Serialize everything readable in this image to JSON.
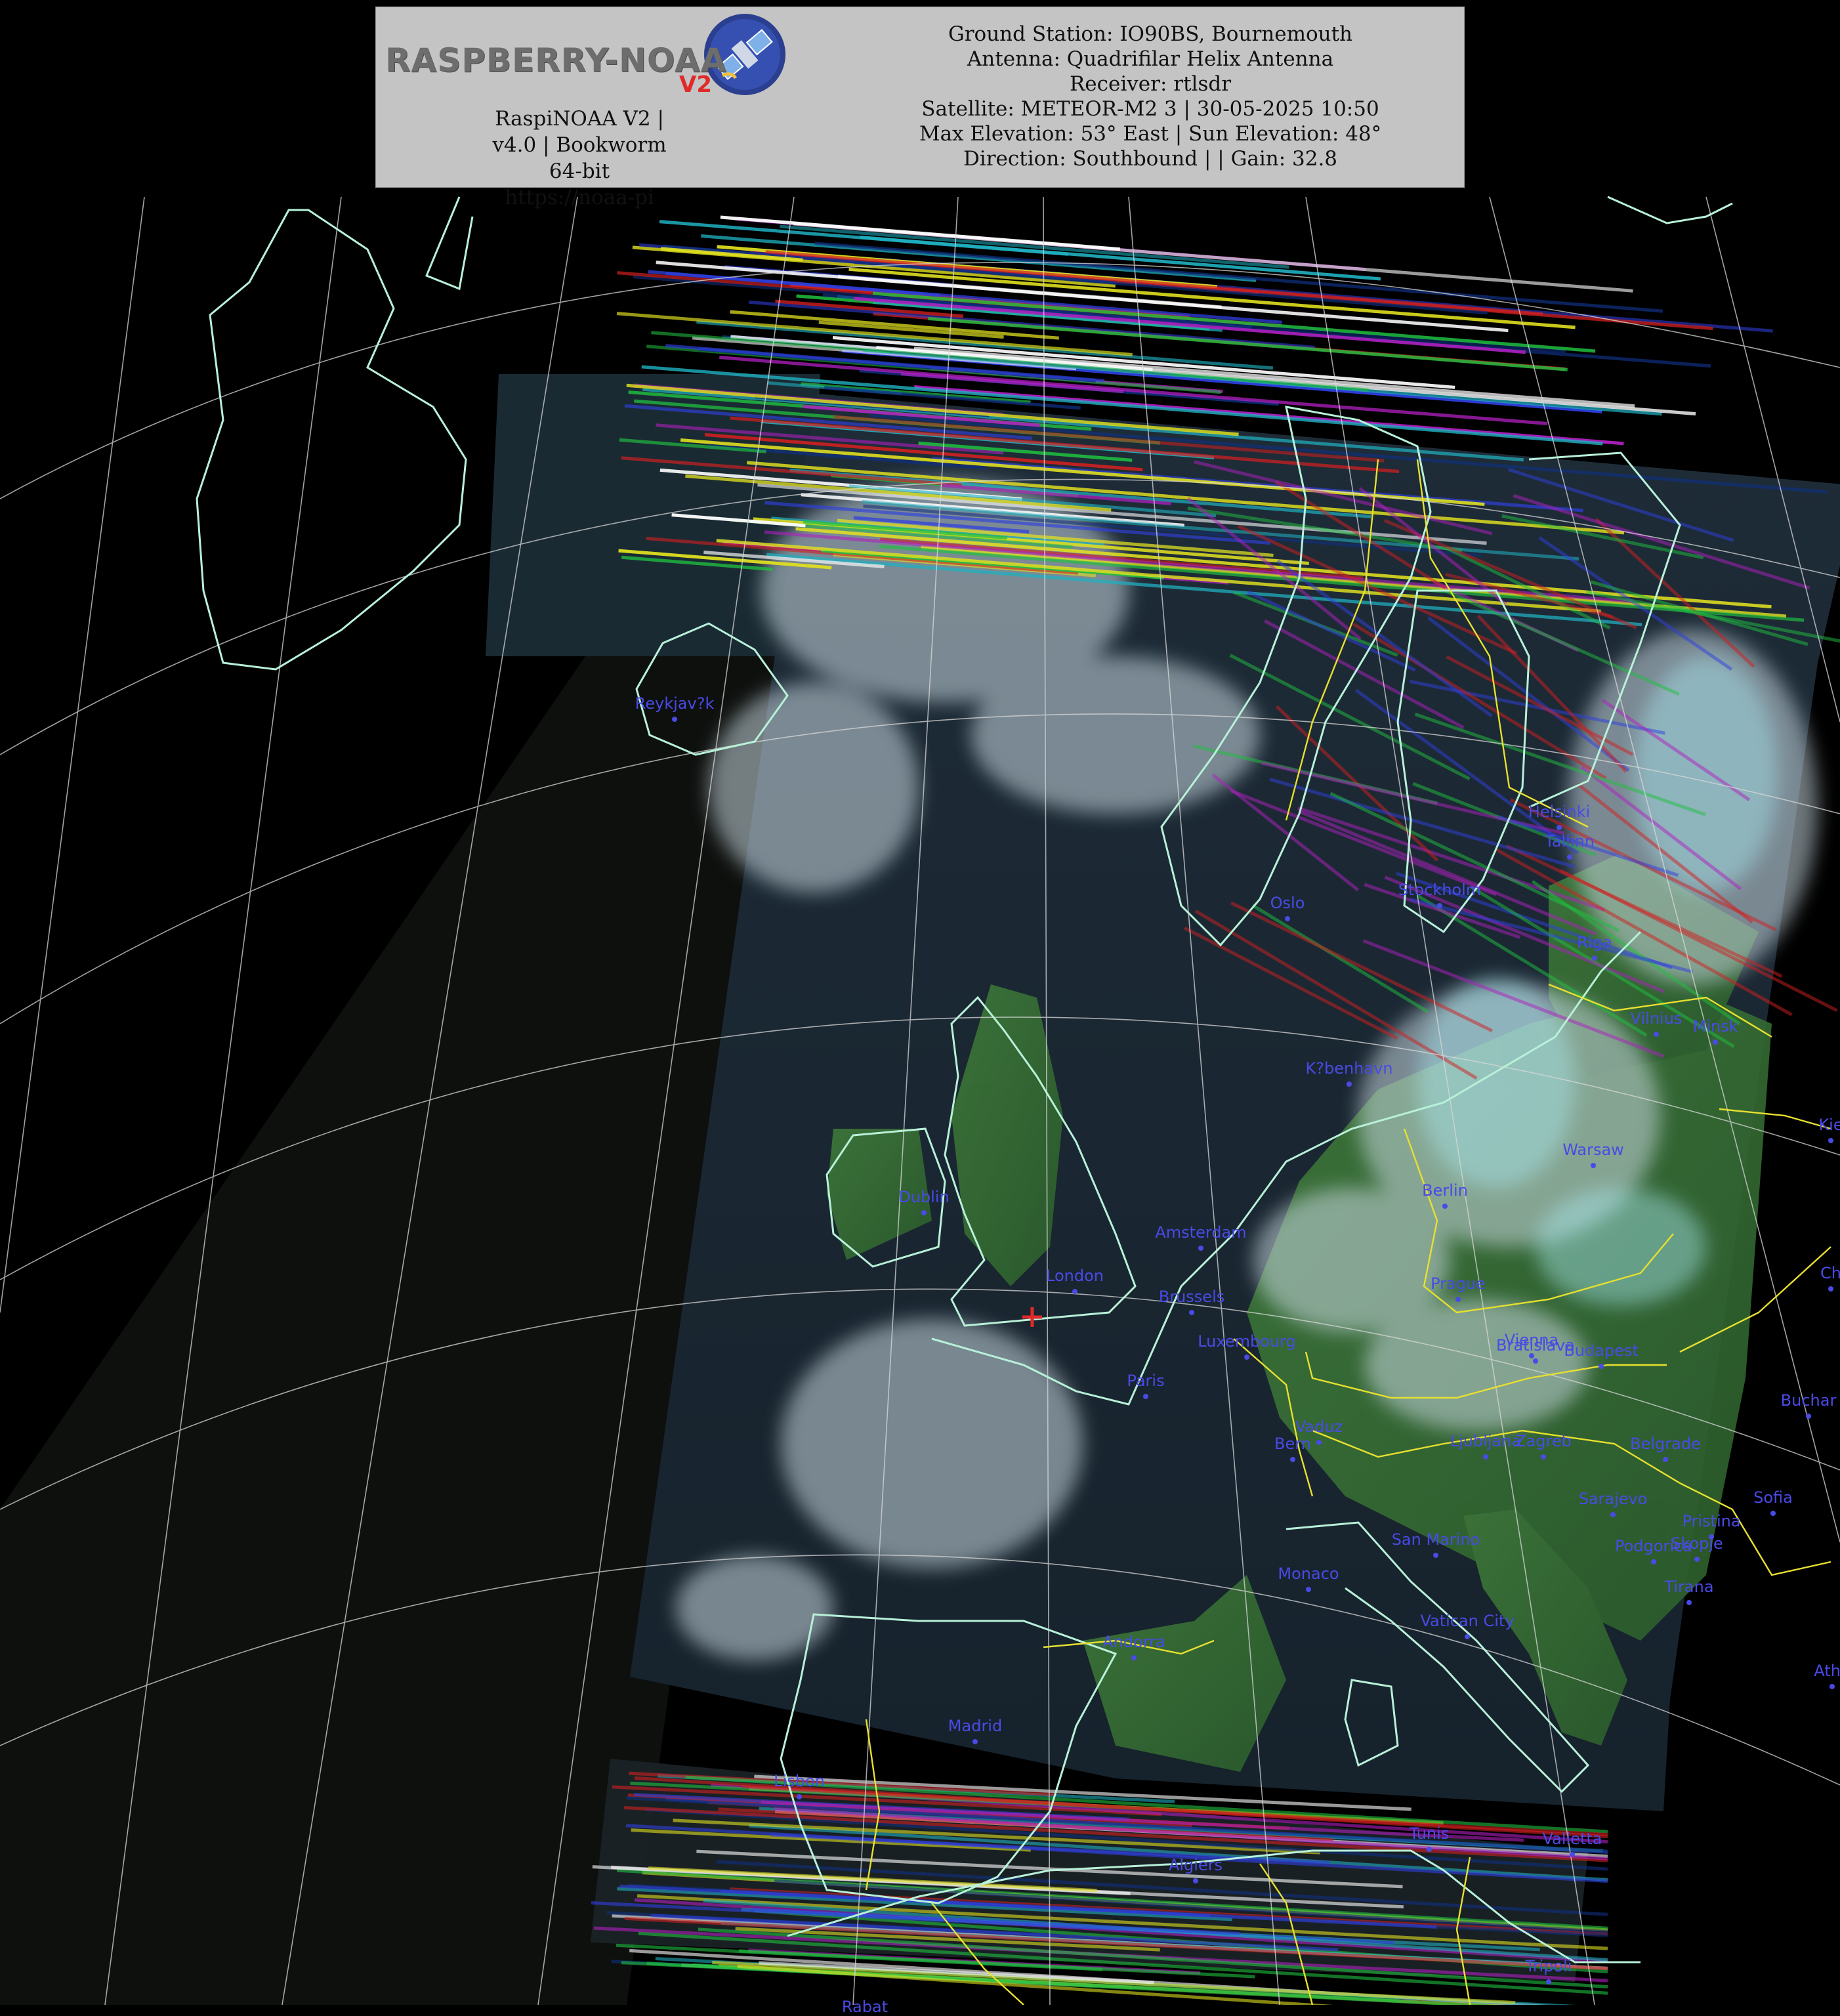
{
  "header": {
    "logo_text": "RASPBERRY-NOAA",
    "logo_suffix": "V2",
    "version_line": "RaspiNOAA V2 | v4.0 | Bookworm 64-bit",
    "url": "https://noaa-pi",
    "details": [
      "Ground Station: IO90BS, Bournemouth",
      "Antenna: Quadrifilar Helix Antenna",
      "Receiver: rtlsdr",
      "Satellite: METEOR-M2 3 | 30-05-2025 10:50",
      "Max Elevation: 53° East | Sun Elevation: 48°",
      "Direction: Southbound | | Gain: 32.8"
    ]
  },
  "map": {
    "cities": [
      "Reykjav?k",
      "Helsinki",
      "Tallinn",
      "Oslo",
      "Stockholm",
      "Riga",
      "Vilnius",
      "Minsk",
      "K?benhavn",
      "Kie",
      "Warsaw",
      "Dublin",
      "Berlin",
      "Amsterdam",
      "London",
      "Brussels",
      "Ch",
      "Prague",
      "Luxembourg",
      "Vienna",
      "Bratislava",
      "Budapest",
      "Paris",
      "Buchar",
      "Vaduz",
      "Bern",
      "Ljubljana",
      "Zagreb",
      "Belgrade",
      "Sarajevo",
      "Sofia",
      "Pristina",
      "San Marino",
      "Podgorica",
      "Skopje",
      "Monaco",
      "Tirana",
      "Vatican City",
      "Andorra",
      "Athe",
      "Madrid",
      "Lisbon",
      "Tunis",
      "Valletta",
      "Algiers",
      "Rabat",
      "Tripoli"
    ],
    "colors": {
      "graticule": "#d8d8d8",
      "coastline": "#b8f0d8",
      "borders": "#e8e030",
      "city_label": "#4a4ae6",
      "station_marker": "#e02a2a"
    },
    "station_marker_icon": "red-cross"
  }
}
